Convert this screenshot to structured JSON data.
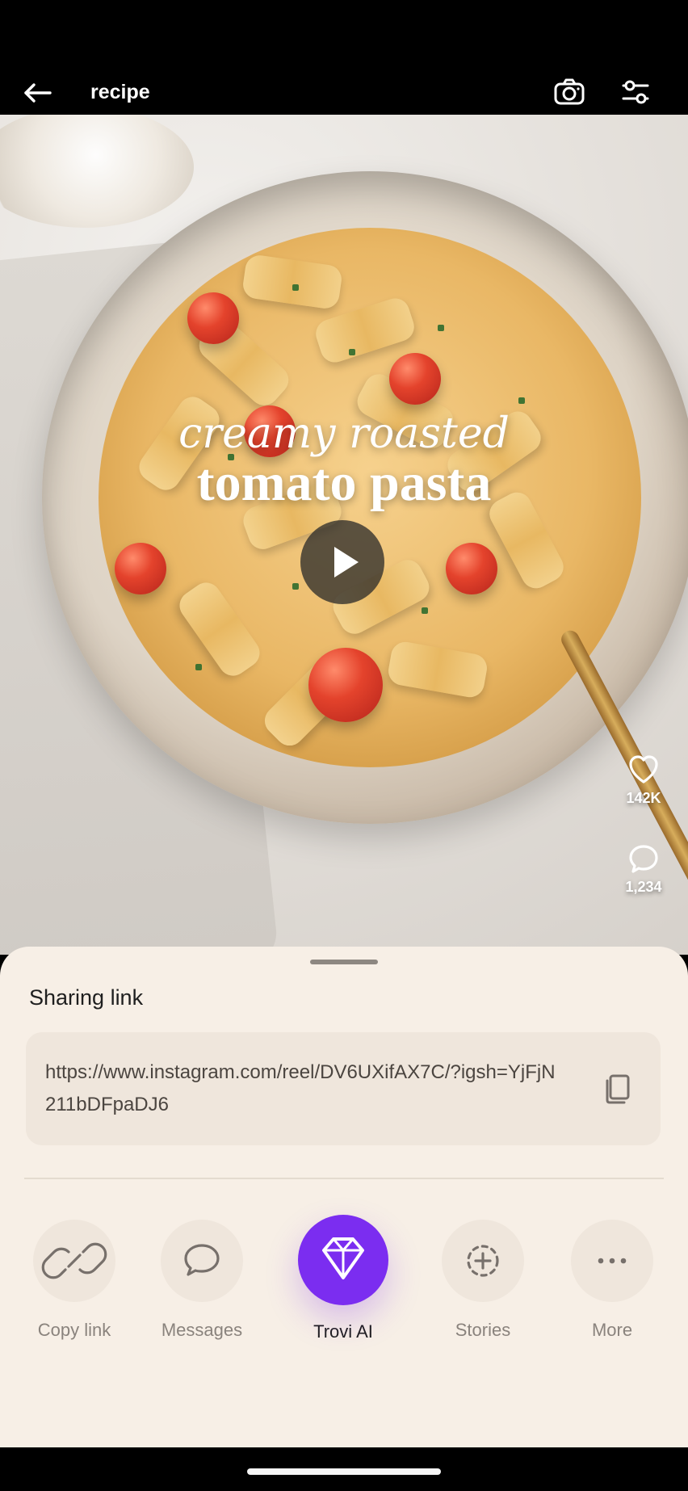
{
  "top_bar": {
    "title": "recipe",
    "back_icon": "arrow-left-icon",
    "camera_icon": "camera-icon",
    "filter_icon": "sliders-icon"
  },
  "media": {
    "overlay_line1": "creamy roasted",
    "overlay_line2": "tomato pasta",
    "likes_count": "142K",
    "comments_count": "1,234"
  },
  "share_sheet": {
    "title": "Sharing link",
    "link": "https://www.instagram.com/reel/DV6UXifAX7C/?igsh=YjFjN211bDFpaDJ6",
    "copy_icon": "copy-icon",
    "actions": [
      {
        "label": "Copy link",
        "icon": "link-icon",
        "selected": false
      },
      {
        "label": "Messages",
        "icon": "chat-bubble-icon",
        "selected": false
      },
      {
        "label": "Trovi AI",
        "icon": "diamond-icon",
        "selected": true
      },
      {
        "label": "Stories",
        "icon": "story-plus-icon",
        "selected": false
      },
      {
        "label": "More",
        "icon": "more-dots-icon",
        "selected": false
      }
    ]
  },
  "colors": {
    "sheet_bg": "#f7efe6",
    "card_bg": "#efe6dc",
    "selected_accent": "#7b2df0"
  }
}
